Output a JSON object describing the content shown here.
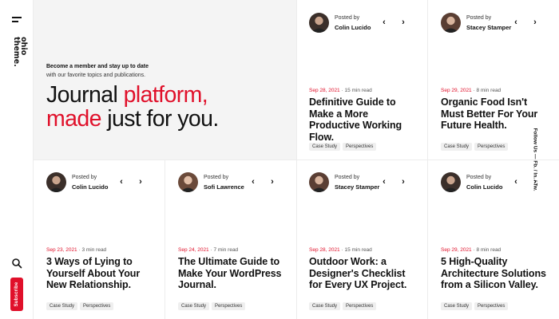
{
  "rail": {
    "logo_line1": "ohio",
    "logo_line2": "theme.",
    "subscribe_label": "Subscribe"
  },
  "hero": {
    "kicker": "Become a member and stay up to date",
    "sub": "with our favorite topics and publications.",
    "title_part1": "Journal ",
    "title_part2": "platform,",
    "title_part3": "made",
    "title_part4": " just for you."
  },
  "posted_by_label": "Posted by",
  "cards": [
    {
      "author": "Colin Lucido",
      "date": "Sep 28, 2021",
      "read": " · 15 min read",
      "title": "Definitive Guide to Make a More Productive Working Flow.",
      "tags": [
        "Case Study",
        "Perspectives"
      ]
    },
    {
      "author": "Stacey Stamper",
      "date": "Sep 29, 2021",
      "read": " · 8 min read",
      "title": "Organic Food Isn't Must Better For Your Future Health.",
      "tags": [
        "Case Study",
        "Perspectives"
      ]
    },
    {
      "author": "Colin Lucido",
      "date": "Sep 23, 2021",
      "read": " · 3 min read",
      "title": "3 Ways of Lying to Yourself About Your New Relationship.",
      "tags": [
        "Case Study",
        "Perspectives"
      ]
    },
    {
      "author": "Sofi Lawrence",
      "date": "Sep 24, 2021",
      "read": " · 7 min read",
      "title": "The Ultimate Guide to Make Your WordPress Journal.",
      "tags": [
        "Case Study",
        "Perspectives"
      ]
    },
    {
      "author": "Stacey Stamper",
      "date": "Sep 28, 2021",
      "read": " · 15 min read",
      "title": "Outdoor Work: a Designer's Checklist for Every UX Project.",
      "tags": [
        "Case Study",
        "Perspectives"
      ]
    },
    {
      "author": "Colin Lucido",
      "date": "Sep 29, 2021",
      "read": " · 8 min read",
      "title": "5 High-Quality Architecture Solutions from a Silicon Valley.",
      "tags": [
        "Case Study",
        "Perspectives"
      ]
    }
  ],
  "social": {
    "text": "Follow Us — Fb. / In. / Tw."
  },
  "colors": {
    "accent": "#e0102a",
    "hero_bg": "#f4f4f4"
  }
}
